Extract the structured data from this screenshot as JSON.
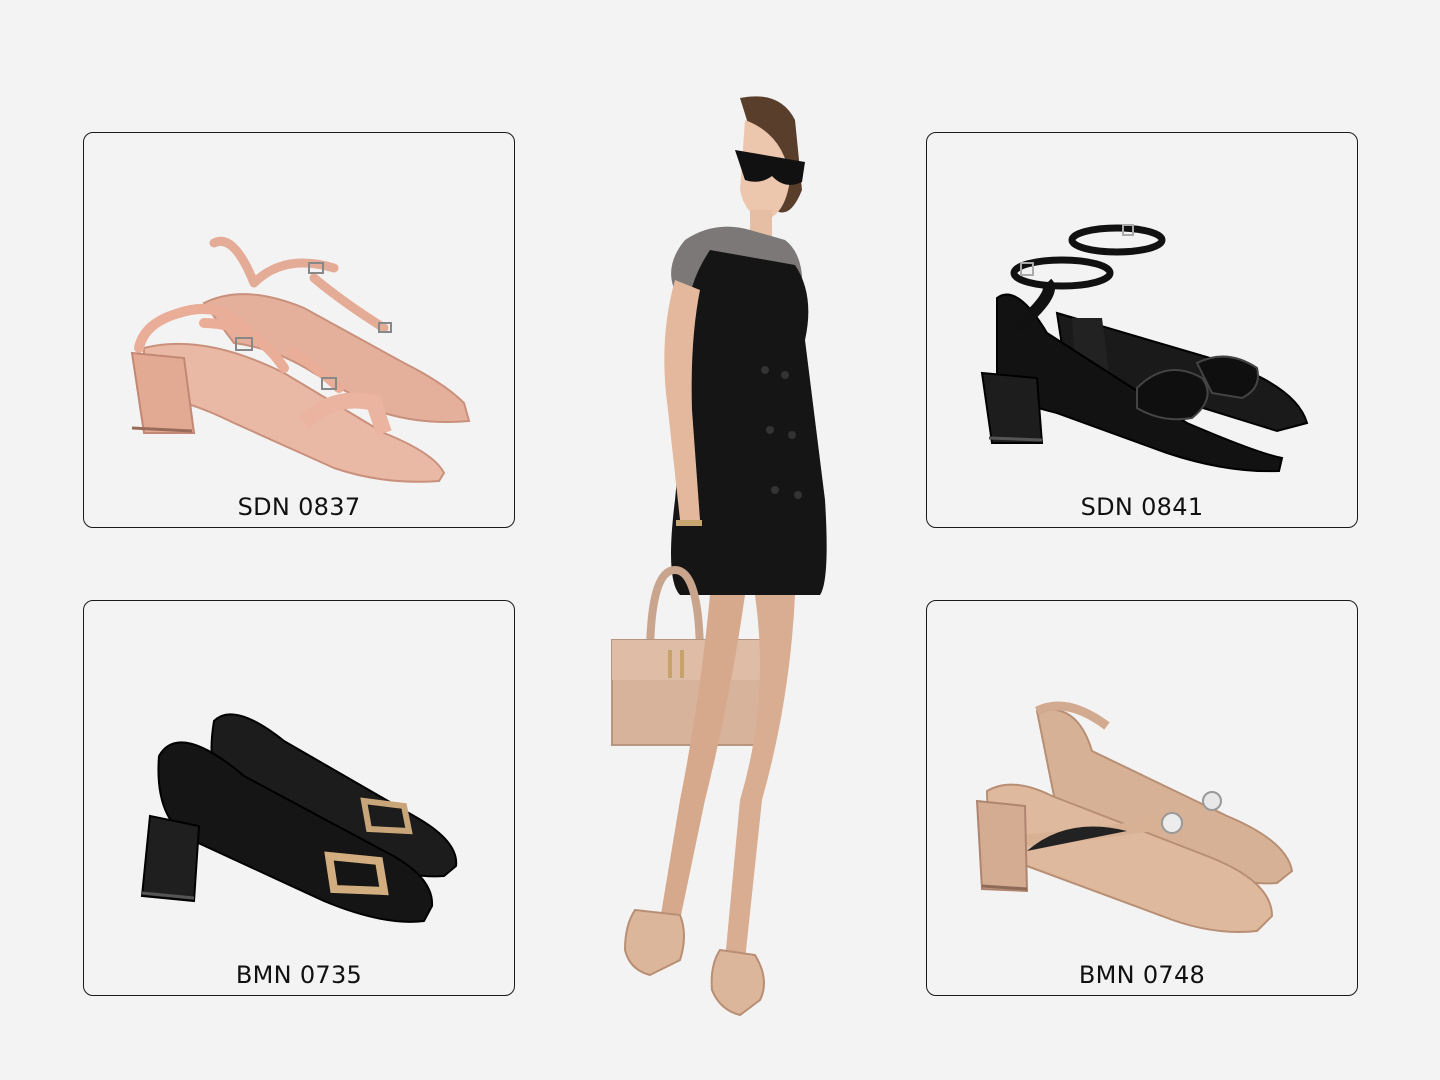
{
  "products": [
    {
      "code": "SDN 0837",
      "style": "strappy block-heel sandal",
      "color": "#e7b6a3"
    },
    {
      "code": "SDN 0841",
      "style": "ankle-strap block-heel sandal",
      "color": "#141414"
    },
    {
      "code": "BMN 0735",
      "style": "buckle block-heel pump",
      "color": "#1b1b1b"
    },
    {
      "code": "BMN 0748",
      "style": "slingback mary jane",
      "color": "#d9b49a"
    }
  ],
  "colors": {
    "background": "#f4f3f3",
    "card_border": "#1a1a1a",
    "nude": "#e7b6a3",
    "black": "#141414"
  }
}
